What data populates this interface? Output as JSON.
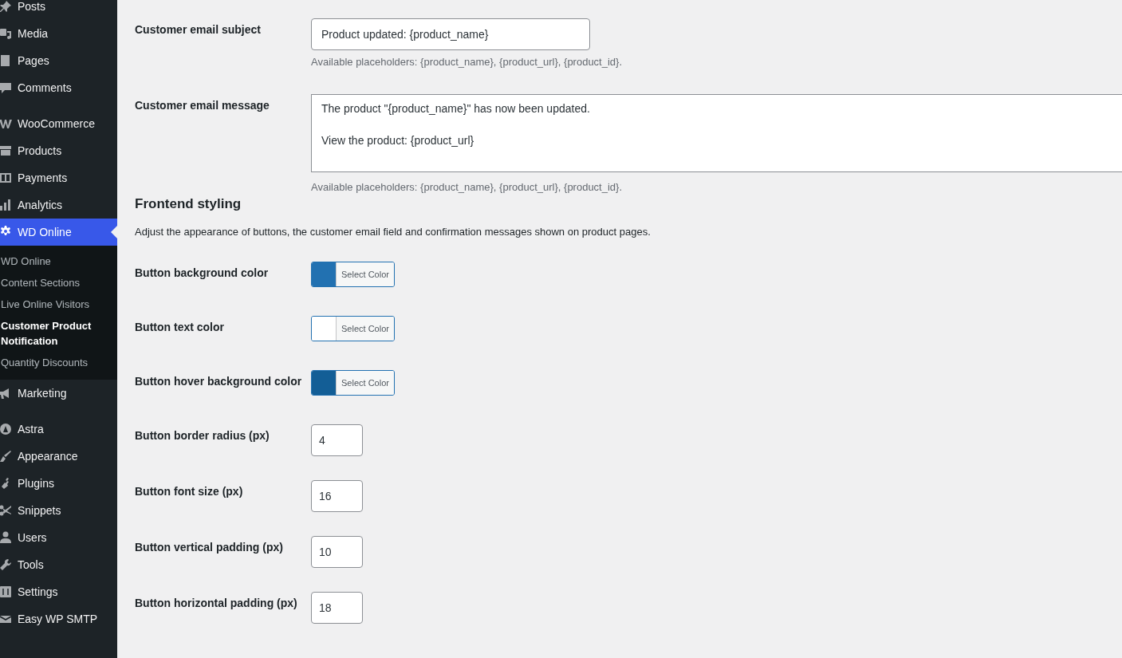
{
  "sidebar": {
    "groups": [
      [
        {
          "label": "Posts",
          "selected": false
        },
        {
          "label": "Media",
          "selected": false
        },
        {
          "label": "Pages",
          "selected": false
        },
        {
          "label": "Comments",
          "selected": false
        }
      ],
      [
        {
          "label": "WooCommerce",
          "selected": false
        },
        {
          "label": "Products",
          "selected": false
        },
        {
          "label": "Payments",
          "selected": false
        },
        {
          "label": "Analytics",
          "selected": false
        },
        {
          "label": "WD Online",
          "selected": true,
          "children": [
            {
              "label": "WD Online",
              "selected": false
            },
            {
              "label": "Content Sections",
              "selected": false
            },
            {
              "label": "Live Online Visitors",
              "selected": false
            },
            {
              "label": "Customer Product Notification",
              "selected": true
            },
            {
              "label": "Quantity Discounts",
              "selected": false
            }
          ]
        },
        {
          "label": "Marketing",
          "selected": false
        }
      ],
      [
        {
          "label": "Astra",
          "selected": false
        },
        {
          "label": "Appearance",
          "selected": false
        },
        {
          "label": "Plugins",
          "selected": false
        },
        {
          "label": "Snippets",
          "selected": false
        },
        {
          "label": "Users",
          "selected": false
        },
        {
          "label": "Tools",
          "selected": false
        },
        {
          "label": "Settings",
          "selected": false
        },
        {
          "label": "Easy WP SMTP",
          "selected": false
        }
      ]
    ]
  },
  "email_fields": [
    {
      "kind": "text",
      "label": "Customer email subject",
      "value": "Product updated: {product_name}",
      "help": "Available placeholders: {product_name}, {product_url}, {product_id}."
    },
    {
      "kind": "textarea",
      "label": "Customer email message",
      "value": "The product \"{product_name}\" has now been updated.\n\nView the product: {product_url}",
      "help": "Available placeholders: {product_name}, {product_url}, {product_id}."
    }
  ],
  "section": {
    "title": "Frontend styling",
    "description": "Adjust the appearance of buttons, the customer email field and confirmation messages shown on product pages."
  },
  "style_fields": [
    {
      "kind": "color",
      "label": "Button background color",
      "color": "#2271b1",
      "button": "Select Color"
    },
    {
      "kind": "color",
      "label": "Button text color",
      "color": "#ffffff",
      "button": "Select Color"
    },
    {
      "kind": "color",
      "label": "Button hover background color",
      "color": "#135e96",
      "button": "Select Color"
    },
    {
      "kind": "number",
      "label": "Button border radius (px)",
      "value": "4"
    },
    {
      "kind": "number",
      "label": "Button font size (px)",
      "value": "16"
    },
    {
      "kind": "number",
      "label": "Button vertical padding (px)",
      "value": "10"
    },
    {
      "kind": "number",
      "label": "Button horizontal padding (px)",
      "value": "18"
    }
  ]
}
